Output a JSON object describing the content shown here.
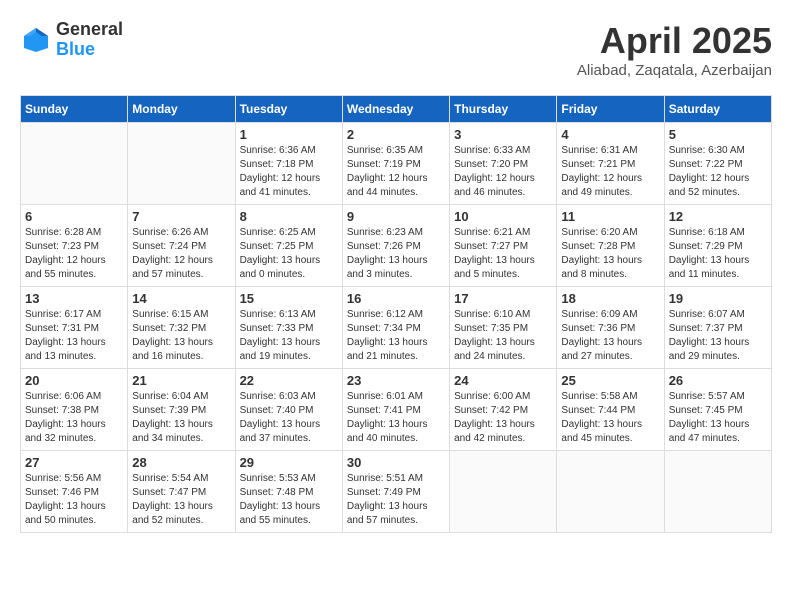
{
  "header": {
    "logo_general": "General",
    "logo_blue": "Blue",
    "month_title": "April 2025",
    "subtitle": "Aliabad, Zaqatala, Azerbaijan"
  },
  "weekdays": [
    "Sunday",
    "Monday",
    "Tuesday",
    "Wednesday",
    "Thursday",
    "Friday",
    "Saturday"
  ],
  "weeks": [
    [
      {
        "day": "",
        "info": ""
      },
      {
        "day": "",
        "info": ""
      },
      {
        "day": "1",
        "info": "Sunrise: 6:36 AM\nSunset: 7:18 PM\nDaylight: 12 hours and 41 minutes."
      },
      {
        "day": "2",
        "info": "Sunrise: 6:35 AM\nSunset: 7:19 PM\nDaylight: 12 hours and 44 minutes."
      },
      {
        "day": "3",
        "info": "Sunrise: 6:33 AM\nSunset: 7:20 PM\nDaylight: 12 hours and 46 minutes."
      },
      {
        "day": "4",
        "info": "Sunrise: 6:31 AM\nSunset: 7:21 PM\nDaylight: 12 hours and 49 minutes."
      },
      {
        "day": "5",
        "info": "Sunrise: 6:30 AM\nSunset: 7:22 PM\nDaylight: 12 hours and 52 minutes."
      }
    ],
    [
      {
        "day": "6",
        "info": "Sunrise: 6:28 AM\nSunset: 7:23 PM\nDaylight: 12 hours and 55 minutes."
      },
      {
        "day": "7",
        "info": "Sunrise: 6:26 AM\nSunset: 7:24 PM\nDaylight: 12 hours and 57 minutes."
      },
      {
        "day": "8",
        "info": "Sunrise: 6:25 AM\nSunset: 7:25 PM\nDaylight: 13 hours and 0 minutes."
      },
      {
        "day": "9",
        "info": "Sunrise: 6:23 AM\nSunset: 7:26 PM\nDaylight: 13 hours and 3 minutes."
      },
      {
        "day": "10",
        "info": "Sunrise: 6:21 AM\nSunset: 7:27 PM\nDaylight: 13 hours and 5 minutes."
      },
      {
        "day": "11",
        "info": "Sunrise: 6:20 AM\nSunset: 7:28 PM\nDaylight: 13 hours and 8 minutes."
      },
      {
        "day": "12",
        "info": "Sunrise: 6:18 AM\nSunset: 7:29 PM\nDaylight: 13 hours and 11 minutes."
      }
    ],
    [
      {
        "day": "13",
        "info": "Sunrise: 6:17 AM\nSunset: 7:31 PM\nDaylight: 13 hours and 13 minutes."
      },
      {
        "day": "14",
        "info": "Sunrise: 6:15 AM\nSunset: 7:32 PM\nDaylight: 13 hours and 16 minutes."
      },
      {
        "day": "15",
        "info": "Sunrise: 6:13 AM\nSunset: 7:33 PM\nDaylight: 13 hours and 19 minutes."
      },
      {
        "day": "16",
        "info": "Sunrise: 6:12 AM\nSunset: 7:34 PM\nDaylight: 13 hours and 21 minutes."
      },
      {
        "day": "17",
        "info": "Sunrise: 6:10 AM\nSunset: 7:35 PM\nDaylight: 13 hours and 24 minutes."
      },
      {
        "day": "18",
        "info": "Sunrise: 6:09 AM\nSunset: 7:36 PM\nDaylight: 13 hours and 27 minutes."
      },
      {
        "day": "19",
        "info": "Sunrise: 6:07 AM\nSunset: 7:37 PM\nDaylight: 13 hours and 29 minutes."
      }
    ],
    [
      {
        "day": "20",
        "info": "Sunrise: 6:06 AM\nSunset: 7:38 PM\nDaylight: 13 hours and 32 minutes."
      },
      {
        "day": "21",
        "info": "Sunrise: 6:04 AM\nSunset: 7:39 PM\nDaylight: 13 hours and 34 minutes."
      },
      {
        "day": "22",
        "info": "Sunrise: 6:03 AM\nSunset: 7:40 PM\nDaylight: 13 hours and 37 minutes."
      },
      {
        "day": "23",
        "info": "Sunrise: 6:01 AM\nSunset: 7:41 PM\nDaylight: 13 hours and 40 minutes."
      },
      {
        "day": "24",
        "info": "Sunrise: 6:00 AM\nSunset: 7:42 PM\nDaylight: 13 hours and 42 minutes."
      },
      {
        "day": "25",
        "info": "Sunrise: 5:58 AM\nSunset: 7:44 PM\nDaylight: 13 hours and 45 minutes."
      },
      {
        "day": "26",
        "info": "Sunrise: 5:57 AM\nSunset: 7:45 PM\nDaylight: 13 hours and 47 minutes."
      }
    ],
    [
      {
        "day": "27",
        "info": "Sunrise: 5:56 AM\nSunset: 7:46 PM\nDaylight: 13 hours and 50 minutes."
      },
      {
        "day": "28",
        "info": "Sunrise: 5:54 AM\nSunset: 7:47 PM\nDaylight: 13 hours and 52 minutes."
      },
      {
        "day": "29",
        "info": "Sunrise: 5:53 AM\nSunset: 7:48 PM\nDaylight: 13 hours and 55 minutes."
      },
      {
        "day": "30",
        "info": "Sunrise: 5:51 AM\nSunset: 7:49 PM\nDaylight: 13 hours and 57 minutes."
      },
      {
        "day": "",
        "info": ""
      },
      {
        "day": "",
        "info": ""
      },
      {
        "day": "",
        "info": ""
      }
    ]
  ]
}
